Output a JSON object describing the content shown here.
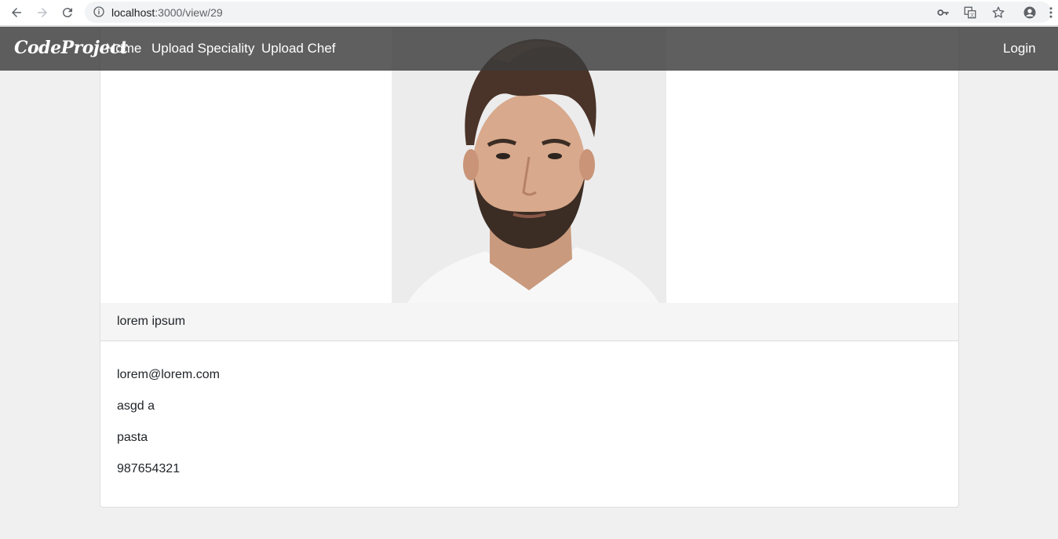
{
  "browser": {
    "url_host": "localhost",
    "url_path": ":3000/view/29"
  },
  "navbar": {
    "brand": "CodeProject",
    "links": [
      "Home",
      "Upload Speciality",
      "Upload Chef"
    ],
    "login": "Login",
    "background": "#3c3c3c"
  },
  "profile": {
    "name": "lorem ipsum",
    "email": "lorem@lorem.com",
    "address": "asgd a",
    "speciality": "pasta",
    "phone": "987654321"
  }
}
